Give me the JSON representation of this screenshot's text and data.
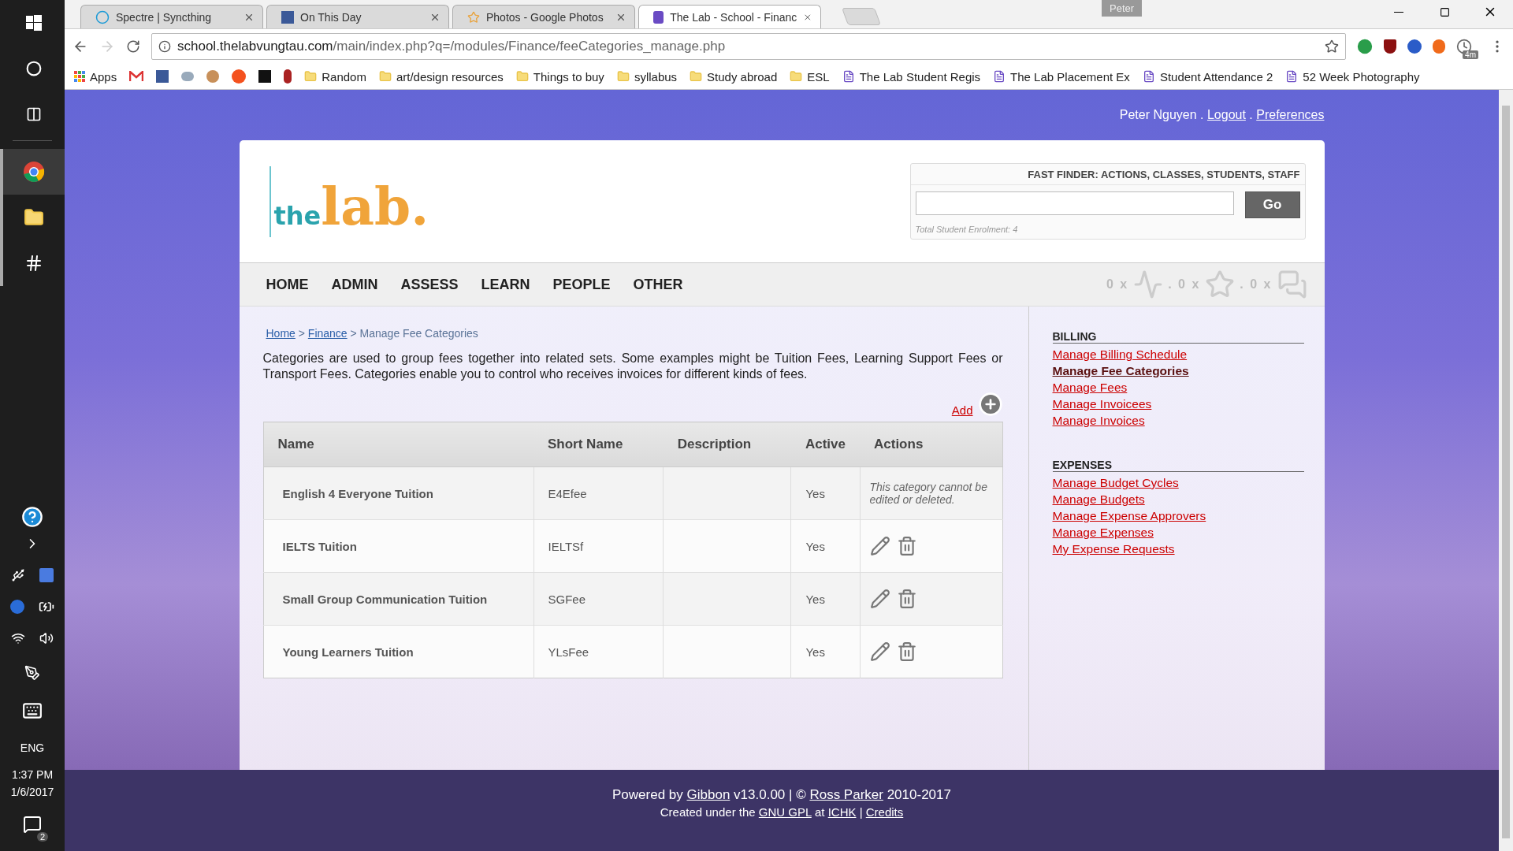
{
  "browser": {
    "tabs": [
      {
        "title": "Spectre | Syncthing",
        "selected": false
      },
      {
        "title": "On This Day",
        "selected": false
      },
      {
        "title": "Photos - Google Photos",
        "selected": false
      },
      {
        "title": "The Lab - School - Financ",
        "selected": true
      }
    ],
    "profile": "Peter",
    "address": {
      "host": "school.thelabvungtau.com",
      "path": "/main/index.php?q=/modules/Finance/feeCategories_manage.php"
    },
    "extension_badge": "4m",
    "bookmarks": [
      {
        "kind": "apps",
        "label": "Apps"
      },
      {
        "kind": "folder",
        "label": "Random"
      },
      {
        "kind": "folder",
        "label": "art/design resources"
      },
      {
        "kind": "folder",
        "label": "Things to buy"
      },
      {
        "kind": "folder",
        "label": "syllabus"
      },
      {
        "kind": "folder",
        "label": "Study abroad"
      },
      {
        "kind": "folder",
        "label": "ESL"
      },
      {
        "kind": "page",
        "label": "The Lab Student Regis"
      },
      {
        "kind": "page",
        "label": "The Lab Placement Ex"
      },
      {
        "kind": "page",
        "label": "Student Attendance 2"
      },
      {
        "kind": "page",
        "label": "52 Week Photography"
      }
    ]
  },
  "taskbar": {
    "language": "ENG",
    "time": "1:37 PM",
    "date": "1/6/2017",
    "notifications": "2"
  },
  "user_line": {
    "name": "Peter Nguyen",
    "links": [
      {
        "separator": " . ",
        "label": "Logout"
      },
      {
        "separator": " . ",
        "label": "Preferences"
      }
    ]
  },
  "logo": {
    "prefix": "the",
    "main": "lab."
  },
  "fast_finder": {
    "title": "FAST FINDER: ACTIONS, CLASSES, STUDENTS, STAFF",
    "button": "Go",
    "note": "Total Student Enrolment: 4"
  },
  "nav": [
    "HOME",
    "ADMIN",
    "ASSESS",
    "LEARN",
    "PEOPLE",
    "OTHER"
  ],
  "alerts": [
    {
      "kind": "pulse",
      "count": "0 x"
    },
    {
      "kind": "star",
      "count": ". 0 x"
    },
    {
      "kind": "chat",
      "count": ". 0 x"
    }
  ],
  "breadcrumb": [
    {
      "text": "Home",
      "link": true
    },
    {
      "text": " > ",
      "link": false
    },
    {
      "text": "Finance",
      "link": true
    },
    {
      "text": " > Manage Fee Categories",
      "link": false
    }
  ],
  "description": "Categories are used to group fees together into related sets. Some examples might be Tuition Fees, Learning Support Fees or Transport Fees. Categories enable you to control who receives invoices for different kinds of fees.",
  "add_label": "Add",
  "table": {
    "columns": [
      "Name",
      "Short Name",
      "Description",
      "Active",
      "Actions"
    ],
    "rows": [
      {
        "kind": "locked",
        "name": "English 4 Everyone Tuition",
        "short_name": "E4Efee",
        "active": "Yes",
        "note": "This category cannot be edited or deleted."
      },
      {
        "kind": "editable",
        "name": "IELTS Tuition",
        "short_name": "IELTSf",
        "active": "Yes"
      },
      {
        "kind": "editable",
        "name": "Small Group Communication Tuition",
        "short_name": "SGFee",
        "active": "Yes"
      },
      {
        "kind": "editable",
        "name": "Young Learners Tuition",
        "short_name": "YLsFee",
        "active": "Yes"
      }
    ]
  },
  "sidebar": [
    {
      "title": "BILLING",
      "links": [
        {
          "label": "Manage Billing Schedule",
          "selected": false
        },
        {
          "label": "Manage Fee Categories",
          "selected": true
        },
        {
          "label": "Manage Fees",
          "selected": false
        },
        {
          "label": "Manage Invoicees",
          "selected": false
        },
        {
          "label": "Manage Invoices",
          "selected": false
        }
      ]
    },
    {
      "title": "EXPENSES",
      "links": [
        {
          "label": "Manage Budget Cycles",
          "selected": false
        },
        {
          "label": "Manage Budgets",
          "selected": false
        },
        {
          "label": "Manage Expense Approvers",
          "selected": false
        },
        {
          "label": "Manage Expenses",
          "selected": false
        },
        {
          "label": "My Expense Requests",
          "selected": false
        }
      ]
    }
  ],
  "footer": [
    [
      {
        "text": "Powered by ",
        "link": false
      },
      {
        "text": "Gibbon",
        "link": true
      },
      {
        "text": " v13.0.00 | © ",
        "link": false
      },
      {
        "text": "Ross Parker",
        "link": true
      },
      {
        "text": " 2010-2017",
        "link": false
      }
    ],
    [
      {
        "text": "Created under the ",
        "link": false
      },
      {
        "text": "GNU GPL",
        "link": true
      },
      {
        "text": " at ",
        "link": false
      },
      {
        "text": "ICHK",
        "link": true
      },
      {
        "text": " | ",
        "link": false
      },
      {
        "text": "Credits",
        "link": true
      }
    ]
  ]
}
